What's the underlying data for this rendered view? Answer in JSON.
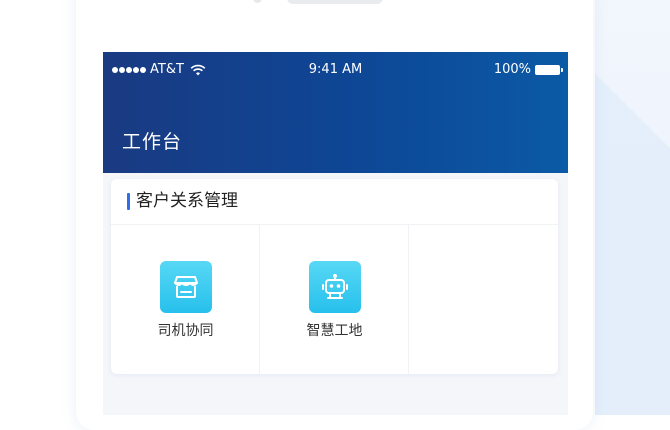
{
  "status_bar": {
    "carrier": "AT&T",
    "time": "9:41 AM",
    "battery": "100%"
  },
  "header": {
    "title": "工作台"
  },
  "section": {
    "title": "客户关系管理",
    "items": [
      {
        "label": "司机协同",
        "icon": "store-icon"
      },
      {
        "label": "智慧工地",
        "icon": "robot-icon"
      }
    ]
  },
  "colors": {
    "header_start": "#1a3a82",
    "header_end": "#0b5aa6",
    "accent": "#2e6ee8",
    "icon_bg": "#27c0ec"
  }
}
